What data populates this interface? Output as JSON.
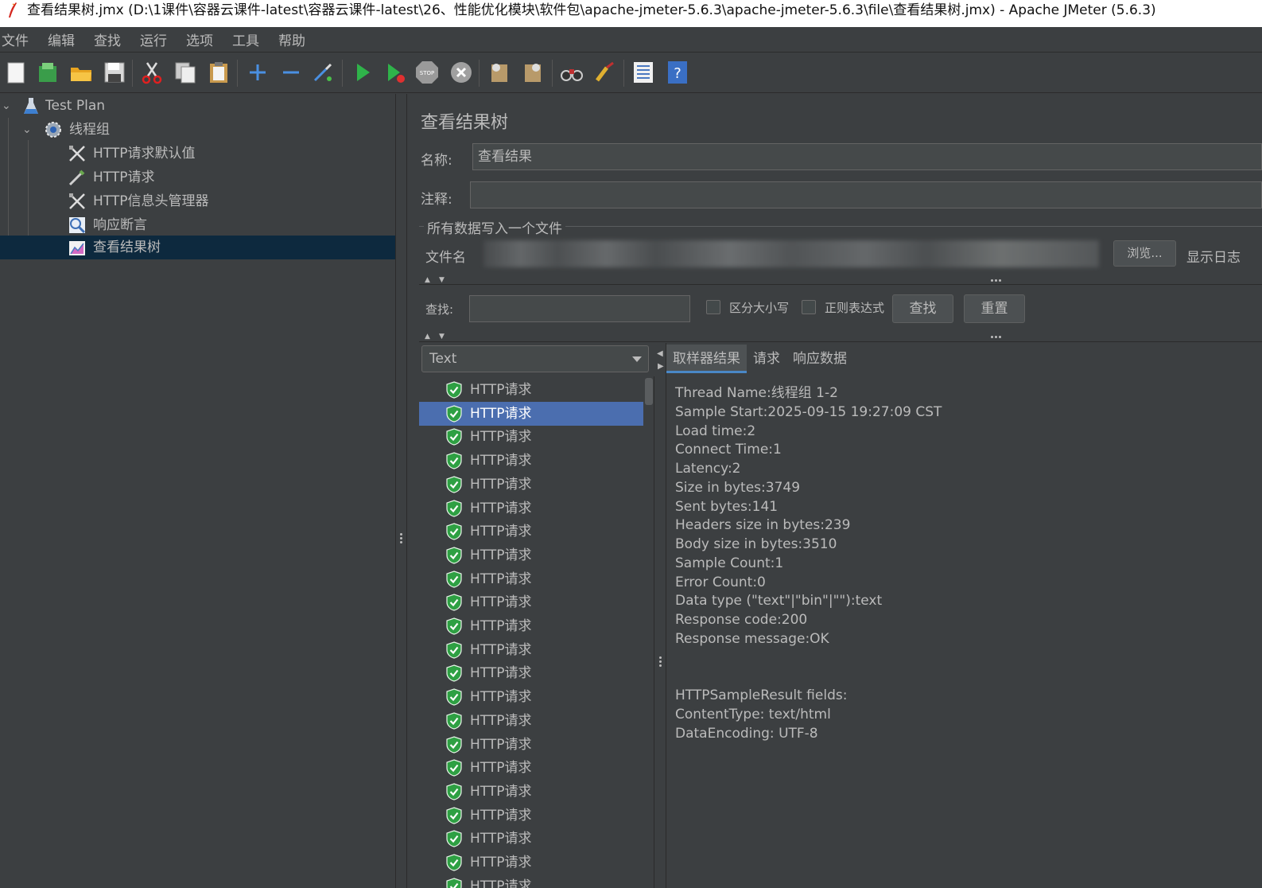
{
  "window": {
    "title": "查看结果树.jmx (D:\\1课件\\容器云课件-latest\\容器云课件-latest\\26、性能优化模块\\软件包\\apache-jmeter-5.6.3\\apache-jmeter-5.6.3\\file\\查看结果树.jmx) - Apache JMeter (5.6.3)"
  },
  "menu": [
    "文件",
    "编辑",
    "查找",
    "运行",
    "选项",
    "工具",
    "帮助"
  ],
  "toolbar": {
    "icons": [
      "new-icon",
      "templates-icon",
      "open-icon",
      "save-icon",
      "cut-icon",
      "copy-icon",
      "paste-icon",
      "expand-icon",
      "collapse-icon",
      "toggle-icon",
      "start-icon",
      "start-no-pause-icon",
      "stop-icon",
      "shutdown-icon",
      "clear-icon",
      "clear-all-icon",
      "search-icon",
      "reset-search-icon",
      "function-helper-icon",
      "help-icon"
    ]
  },
  "tree": {
    "items": [
      {
        "label": "Test Plan",
        "icon": "test-plan-icon"
      },
      {
        "label": "线程组",
        "icon": "thread-group-icon"
      },
      {
        "label": "HTTP请求默认值",
        "icon": "config-element-icon"
      },
      {
        "label": "HTTP请求",
        "icon": "sampler-icon"
      },
      {
        "label": "HTTP信息头管理器",
        "icon": "config-element-icon"
      },
      {
        "label": "响应断言",
        "icon": "assertion-icon"
      },
      {
        "label": "查看结果树",
        "icon": "listener-icon"
      }
    ],
    "selected_index": 6
  },
  "panel": {
    "title": "查看结果树",
    "name_label": "名称:",
    "name_value": "查看结果",
    "comment_label": "注释:",
    "comment_value": "",
    "file_section": "所有数据写入一个文件",
    "file_label": "文件名",
    "browse_button": "浏览...",
    "log_label": "显示日志",
    "search_label": "查找:",
    "search_value": "",
    "case_sensitive_label": "区分大小写",
    "regex_label": "正则表达式",
    "find_button": "查找",
    "reset_button": "重置"
  },
  "results": {
    "renderer": "Text",
    "item_label": "HTTP请求",
    "selected_index": 1,
    "status_icon": "success-shield-icon",
    "accent_color": "#4b6eaf"
  },
  "detail": {
    "tabs": [
      "取样器结果",
      "请求",
      "响应数据"
    ],
    "active_tab": 0,
    "lines": [
      "Thread Name:线程组 1-2",
      "Sample Start:2025-09-15 19:27:09 CST",
      "Load time:2",
      "Connect Time:1",
      "Latency:2",
      "Size in bytes:3749",
      "Sent bytes:141",
      "Headers size in bytes:239",
      "Body size in bytes:3510",
      "Sample Count:1",
      "Error Count:0",
      "Data type (\"text\"|\"bin\"|\"\"):text",
      "Response code:200",
      "Response message:OK",
      "",
      "",
      "HTTPSampleResult fields:",
      "ContentType: text/html",
      "DataEncoding: UTF-8"
    ]
  }
}
